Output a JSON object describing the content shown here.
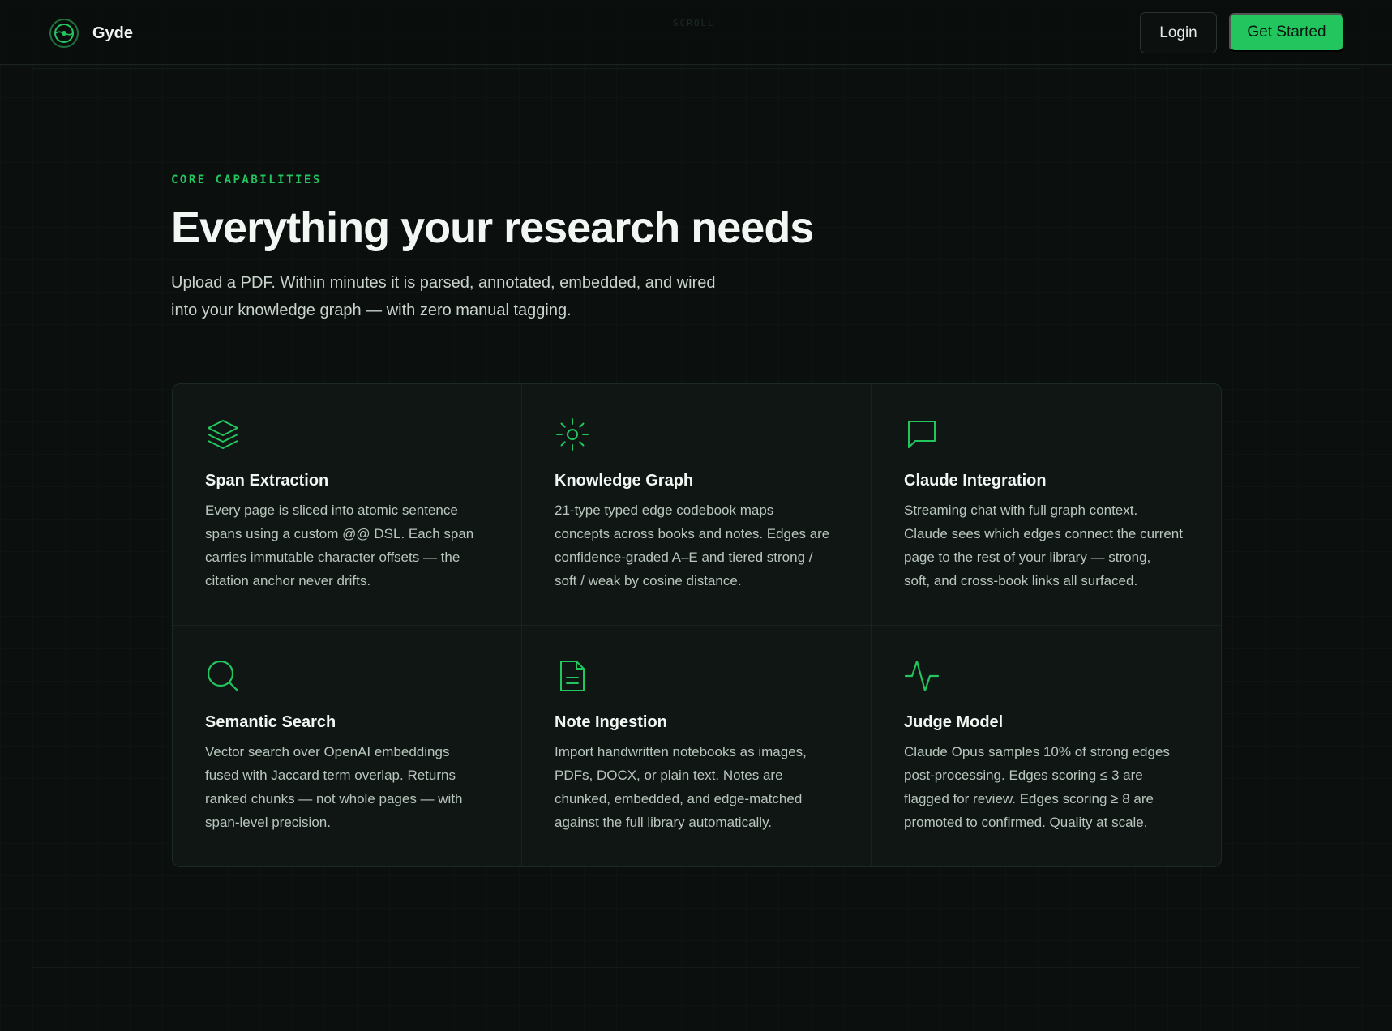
{
  "nav": {
    "brand": "Gyde",
    "scroll_hint": "SCROLL",
    "login_label": "Login",
    "cta_label": "Get Started"
  },
  "hero": {
    "eyebrow": "CORE CAPABILITIES",
    "title": "Everything your research needs",
    "subtitle_line1": "Upload a PDF. Within minutes it is parsed, annotated, embedded, and wired",
    "subtitle_line2": "into your knowledge graph — with zero manual tagging."
  },
  "features": [
    {
      "icon": "layers-icon",
      "title": "Span Extraction",
      "lines": [
        "Every page is sliced into atomic sentence",
        "spans using a custom @@ DSL. Each span",
        "carries immutable character offsets — the",
        "citation anchor never drifts."
      ]
    },
    {
      "icon": "sun-icon",
      "title": "Knowledge Graph",
      "lines": [
        "21-type typed edge codebook maps",
        "concepts across books and notes. Edges are",
        "confidence-graded A–E and tiered strong /",
        "soft / weak by cosine distance."
      ]
    },
    {
      "icon": "chat-bubble-icon",
      "title": "Claude Integration",
      "lines": [
        "Streaming chat with full graph context.",
        "Claude sees which edges connect the current",
        "page to the rest of your library — strong,",
        "soft, and cross-book links all surfaced."
      ]
    },
    {
      "icon": "search-icon",
      "title": "Semantic Search",
      "lines": [
        "Vector search over OpenAI embeddings",
        "fused with Jaccard term overlap. Returns",
        "ranked chunks — not whole pages — with",
        "span-level precision."
      ]
    },
    {
      "icon": "document-icon",
      "title": "Note Ingestion",
      "lines": [
        "Import handwritten notebooks as images,",
        "PDFs, DOCX, or plain text. Notes are",
        "chunked, embedded, and edge-matched",
        "against the full library automatically."
      ]
    },
    {
      "icon": "activity-icon",
      "title": "Judge Model",
      "lines": [
        "Claude Opus samples 10% of strong edges",
        "post-processing. Edges scoring ≤ 3 are",
        "flagged for review. Edges scoring ≥ 8 are",
        "promoted to confirmed. Quality at scale."
      ]
    }
  ],
  "colors": {
    "accent": "#22c55e",
    "background": "#0b100e",
    "card": "#0f1613"
  }
}
